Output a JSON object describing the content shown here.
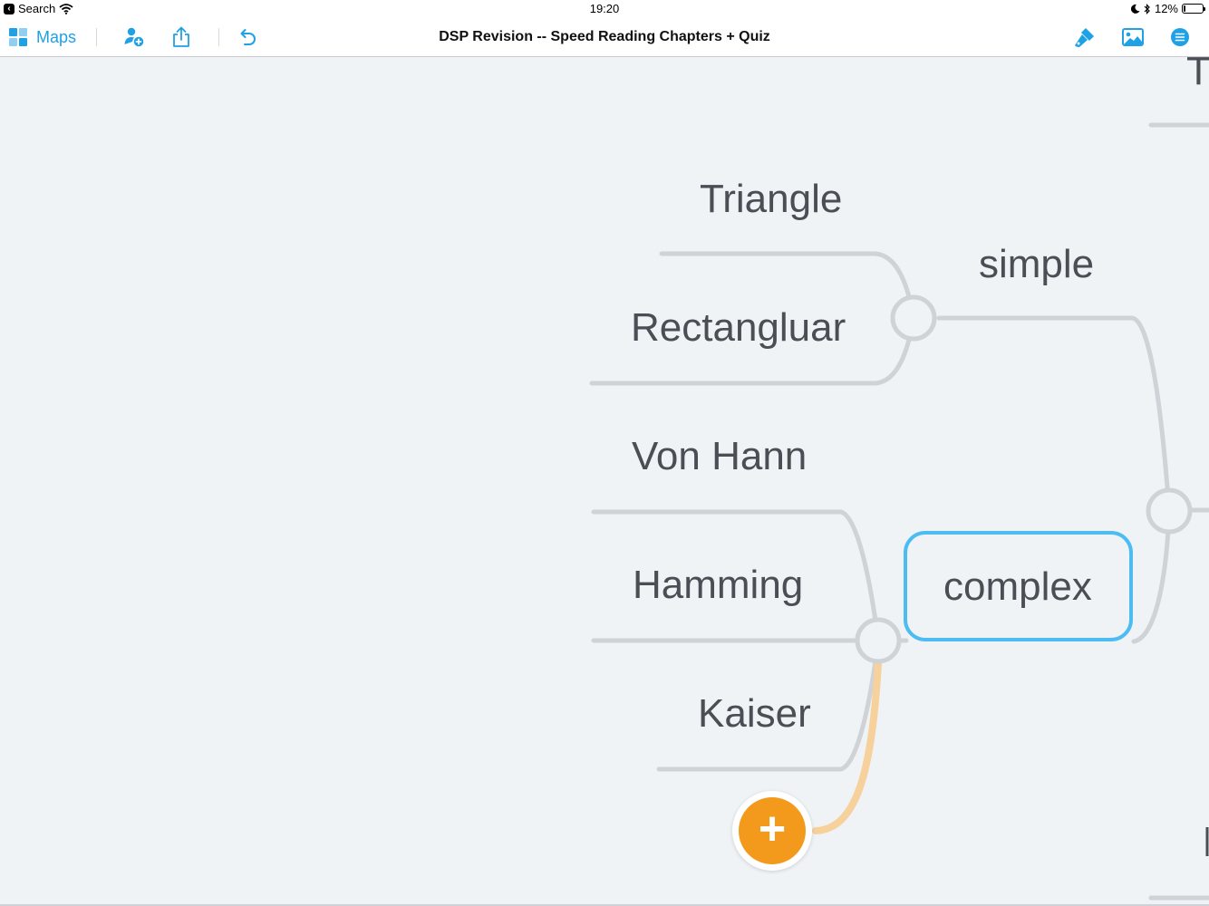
{
  "status_bar": {
    "back_app": "Search",
    "time": "19:20",
    "battery": "12%",
    "battery_level": 0.12
  },
  "toolbar": {
    "maps_label": "Maps",
    "title": "DSP Revision -- Speed Reading Chapters + Quiz",
    "icons": [
      "maps-grid-icon",
      "add-person-icon",
      "share-icon",
      "undo-icon",
      "format-brush-icon",
      "image-icon",
      "outline-list-icon"
    ]
  },
  "mind_map": {
    "nodes": {
      "triangle": "Triangle",
      "rectangluar": "Rectangluar",
      "simple": "simple",
      "von_hann": "Von Hann",
      "hamming": "Hamming",
      "kaiser": "Kaiser",
      "complex": "complex",
      "partial_top_right": "T"
    },
    "selected_node": "complex",
    "colors": {
      "branch": "#cfd3d7",
      "selection": "#4cbcf3",
      "add_button": "#f39a1c",
      "new_branch": "#f7d19c",
      "text": "#4a4f55"
    }
  }
}
